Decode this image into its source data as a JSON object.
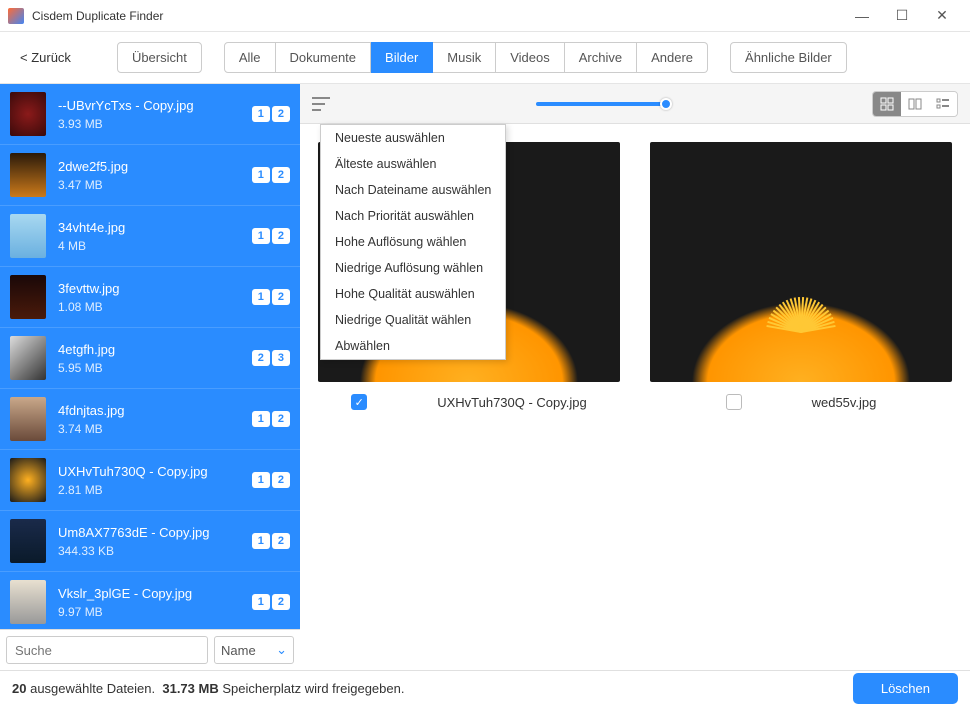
{
  "app": {
    "title": "Cisdem Duplicate Finder"
  },
  "toolbar": {
    "back": "< Zurück",
    "tabs": {
      "overview": "Übersicht",
      "all": "Alle",
      "docs": "Dokumente",
      "images": "Bilder",
      "music": "Musik",
      "videos": "Videos",
      "archives": "Archive",
      "other": "Andere",
      "similar": "Ähnliche Bilder"
    }
  },
  "files": [
    {
      "name": "--UBvrYcTxs - Copy.jpg",
      "size": "3.93 MB",
      "b1": "1",
      "b2": "2",
      "th": "th-red"
    },
    {
      "name": "2dwe2f5.jpg",
      "size": "3.47 MB",
      "b1": "1",
      "b2": "2",
      "th": "th-orange"
    },
    {
      "name": "34vht4e.jpg",
      "size": "4 MB",
      "b1": "1",
      "b2": "2",
      "th": "th-sky"
    },
    {
      "name": "3fevttw.jpg",
      "size": "1.08 MB",
      "b1": "1",
      "b2": "2",
      "th": "th-dark"
    },
    {
      "name": "4etgfh.jpg",
      "size": "5.95 MB",
      "b1": "2",
      "b2": "3",
      "th": "th-bw"
    },
    {
      "name": "4fdnjtas.jpg",
      "size": "3.74 MB",
      "b1": "1",
      "b2": "2",
      "th": "th-port"
    },
    {
      "name": "UXHvTuh730Q - Copy.jpg",
      "size": "2.81 MB",
      "b1": "1",
      "b2": "2",
      "th": "th-yel"
    },
    {
      "name": "Um8AX7763dE - Copy.jpg",
      "size": "344.33 KB",
      "b1": "1",
      "b2": "2",
      "th": "th-blue"
    },
    {
      "name": "Vkslr_3plGE - Copy.jpg",
      "size": "9.97 MB",
      "b1": "1",
      "b2": "2",
      "th": "th-cut"
    }
  ],
  "search": {
    "placeholder": "Suche",
    "sort": "Name"
  },
  "menu": {
    "items": [
      "Neueste auswählen",
      "Älteste auswählen",
      "Nach Dateiname auswählen",
      "Nach Priorität auswählen",
      "Hohe Auflösung wählen",
      "Niedrige Auflösung wählen",
      "Hohe Qualität auswählen",
      "Niedrige Qualität wählen",
      "Abwählen"
    ]
  },
  "preview": {
    "left": {
      "name": "UXHvTuh730Q - Copy.jpg",
      "checked": true
    },
    "right": {
      "name": "wed55v.jpg",
      "checked": false
    }
  },
  "status": {
    "count": "20",
    "label1": "ausgewählte Dateien.",
    "size": "31.73 MB",
    "label2": "Speicherplatz wird freigegeben.",
    "delete": "Löschen"
  }
}
